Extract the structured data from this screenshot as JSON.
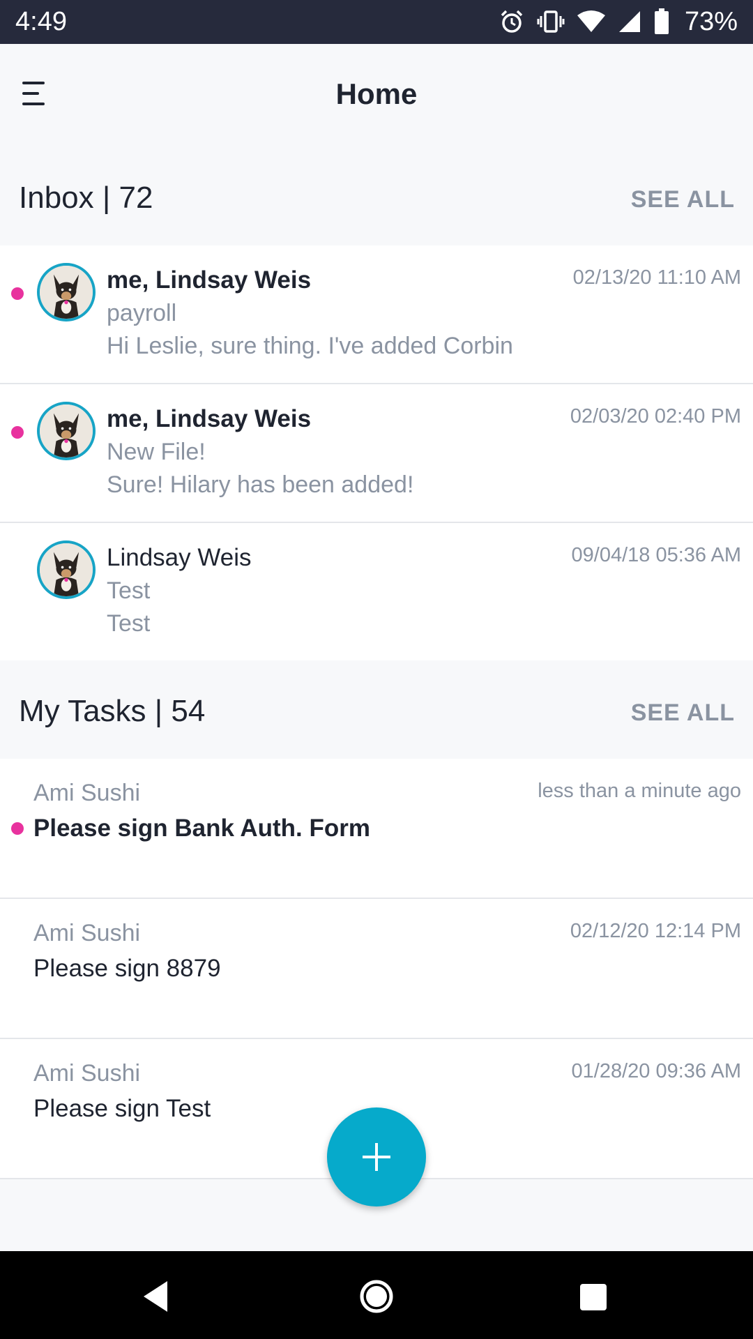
{
  "status_bar": {
    "time": "4:49",
    "battery": "73%",
    "icons": [
      "alarm-icon",
      "vibrate-icon",
      "wifi-icon",
      "signal-icon",
      "battery-icon"
    ]
  },
  "app_bar": {
    "title": "Home",
    "menu_icon": "menu-icon"
  },
  "inbox": {
    "header": "Inbox | 72",
    "see_all": "SEE ALL",
    "messages": [
      {
        "name": "me, Lindsay Weis",
        "subject": "payroll",
        "preview": "Hi Leslie, sure thing. I've added Corbin",
        "date": "02/13/20 11:10 AM",
        "unread": true
      },
      {
        "name": "me, Lindsay Weis",
        "subject": "New File!",
        "preview": "Sure! Hilary has been added!",
        "date": "02/03/20 02:40 PM",
        "unread": true
      },
      {
        "name": "Lindsay Weis",
        "subject": "Test",
        "preview": "Test",
        "date": "09/04/18 05:36 AM",
        "unread": false
      }
    ]
  },
  "tasks": {
    "header": "My Tasks | 54",
    "see_all": "SEE ALL",
    "items": [
      {
        "assignee": "Ami Sushi",
        "title": "Please sign Bank Auth. Form",
        "date": "less than a minute ago",
        "unread": true
      },
      {
        "assignee": "Ami Sushi",
        "title": "Please sign 8879",
        "date": "02/12/20 12:14 PM",
        "unread": false
      },
      {
        "assignee": "Ami Sushi",
        "title": "Please sign Test",
        "date": "01/28/20 09:36 AM",
        "unread": false
      }
    ]
  },
  "fab": {
    "icon": "plus-icon"
  },
  "nav_bar": {
    "icons": [
      "back-icon",
      "home-icon",
      "recents-icon"
    ]
  },
  "colors": {
    "status_bar": "#262a3c",
    "unread_dot": "#e8329e",
    "accent": "#06aacb",
    "avatar_ring": "#17a4c6",
    "muted_text": "#8a93a1"
  }
}
